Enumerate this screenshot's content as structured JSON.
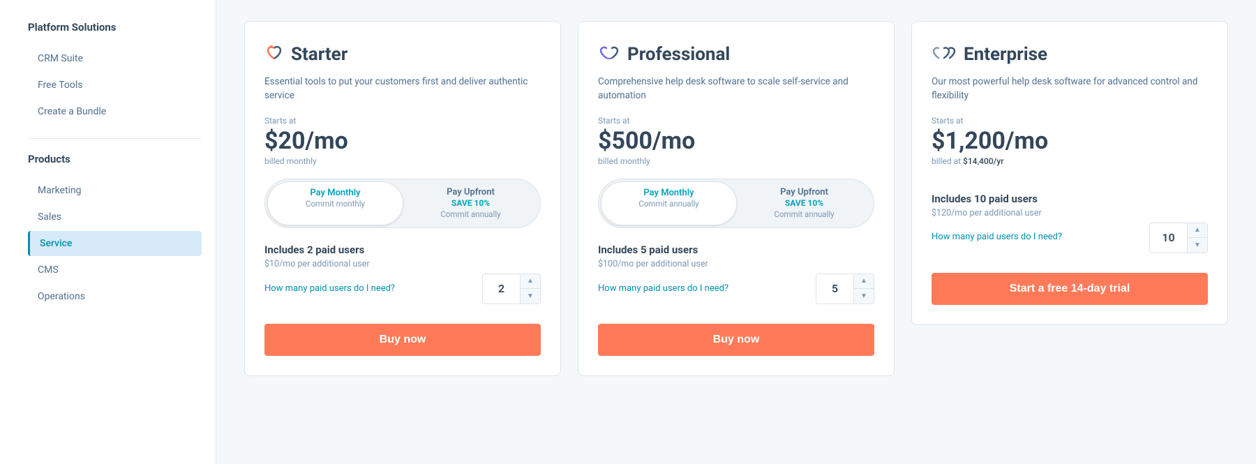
{
  "sidebar": {
    "platform_solutions_label": "Platform Solutions",
    "platform_items": [
      {
        "id": "crm-suite",
        "label": "CRM Suite",
        "active": false
      },
      {
        "id": "free-tools",
        "label": "Free Tools",
        "active": false
      },
      {
        "id": "create-bundle",
        "label": "Create a Bundle",
        "active": false
      }
    ],
    "products_label": "Products",
    "product_items": [
      {
        "id": "marketing",
        "label": "Marketing",
        "active": false
      },
      {
        "id": "sales",
        "label": "Sales",
        "active": false
      },
      {
        "id": "service",
        "label": "Service",
        "active": true
      },
      {
        "id": "cms",
        "label": "CMS",
        "active": false
      },
      {
        "id": "operations",
        "label": "Operations",
        "active": false
      }
    ]
  },
  "plans": [
    {
      "id": "starter",
      "name": "Starter",
      "icon_type": "heart-orange",
      "icon_symbol": "♥",
      "description": "Essential tools to put your customers first and deliver authentic service",
      "starts_at_label": "Starts at",
      "price": "$20/mo",
      "billed_note": "billed monthly",
      "billed_note_extra": null,
      "toggle": {
        "monthly_label": "Pay Monthly",
        "monthly_sub": "Commit monthly",
        "monthly_active": true,
        "upfront_label": "Pay Upfront",
        "upfront_save": "SAVE 10%",
        "upfront_sub": "Commit annually"
      },
      "users": {
        "includes_label": "Includes 2 paid users",
        "per_user_price": "$10/mo per additional user",
        "how_many_label": "How many paid users do I need?",
        "default_value": "2"
      },
      "cta_label": "Buy now"
    },
    {
      "id": "professional",
      "name": "Professional",
      "icon_type": "heart-purple",
      "icon_symbol": "🤍",
      "description": "Comprehensive help desk software to scale self-service and automation",
      "starts_at_label": "Starts at",
      "price": "$500/mo",
      "billed_note": "billed monthly",
      "billed_note_extra": null,
      "toggle": {
        "monthly_label": "Pay Monthly",
        "monthly_sub": "Commit annually",
        "monthly_active": true,
        "upfront_label": "Pay Upfront",
        "upfront_save": "SAVE 10%",
        "upfront_sub": "Commit annually"
      },
      "users": {
        "includes_label": "Includes 5 paid users",
        "per_user_price": "$100/mo per additional user",
        "how_many_label": "How many paid users do I need?",
        "default_value": "5"
      },
      "cta_label": "Buy now"
    },
    {
      "id": "enterprise",
      "name": "Enterprise",
      "icon_type": "heart-dark",
      "icon_symbol": "🖤",
      "description": "Our most powerful help desk software for advanced control and flexibility",
      "starts_at_label": "Starts at",
      "price": "$1,200/mo",
      "billed_note": "billed at ",
      "billed_note_extra": "$14,400/yr",
      "toggle": null,
      "users": {
        "includes_label": "Includes 10 paid users",
        "per_user_price": "$120/mo per additional user",
        "how_many_label": "How many paid users do I need?",
        "default_value": "10"
      },
      "cta_label": "Start a free 14-day trial"
    }
  ]
}
